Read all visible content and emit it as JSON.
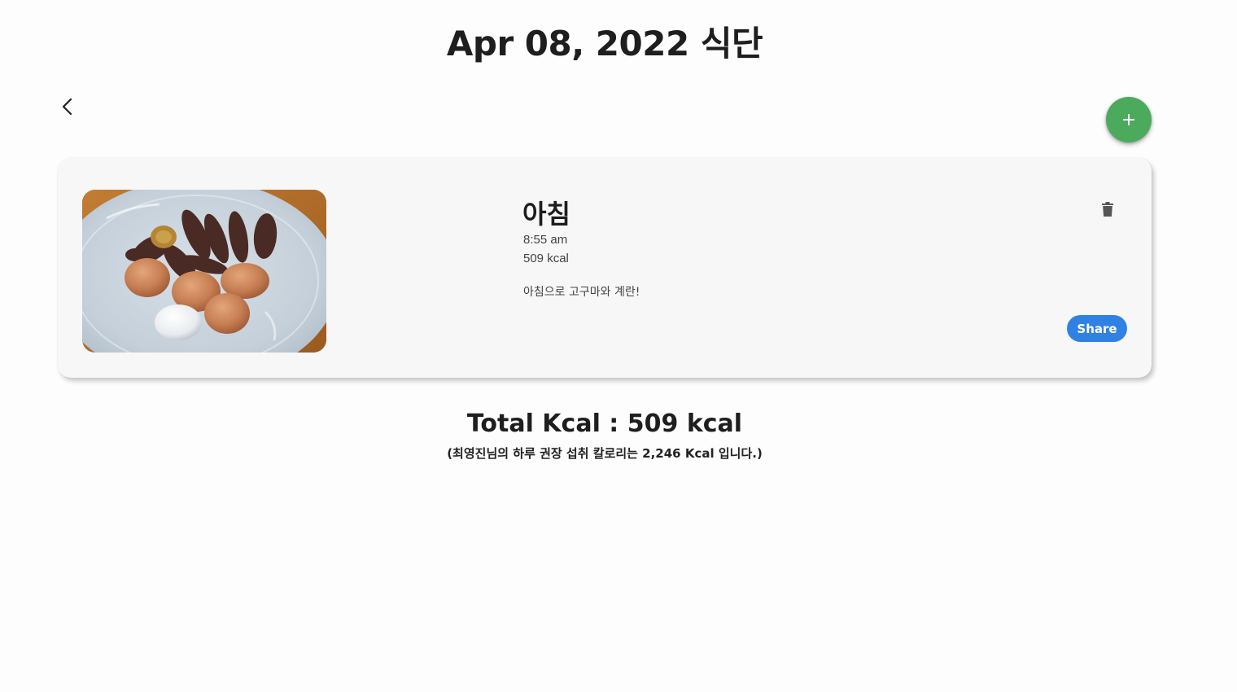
{
  "header": {
    "title": "Apr 08, 2022 식단"
  },
  "toolbar": {
    "back_icon": "chevron-left-icon",
    "add_icon": "plus-icon",
    "add_color": "#4caa5d"
  },
  "meal": {
    "name": "아침",
    "time": "8:55 am",
    "kcal": "509 kcal",
    "memo": "아침으로 고구마와 계란!",
    "photo_description_icon": "meal-photo",
    "delete_icon": "trash-icon",
    "share_label": "Share",
    "share_color": "#2f82e3"
  },
  "summary": {
    "total_label": "Total Kcal : 509 kcal",
    "recommend_text": "(최영진님의 하루 권장 섭취 칼로리는 2,246 Kcal 입니다.)"
  }
}
